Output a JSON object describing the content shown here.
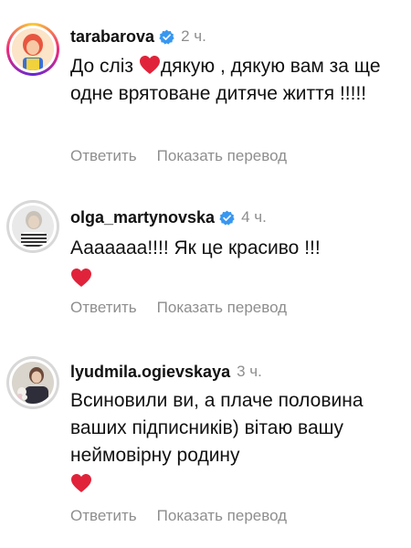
{
  "comments": [
    {
      "username": "tarabarova",
      "verified": true,
      "time": "2 ч.",
      "text_before_heart": "До сліз ",
      "text_after_heart": "дякую , дякую вам за ще одне врятоване дитяче життя !!!!!",
      "reply_label": "Ответить",
      "translate_label": "Показать перевод"
    },
    {
      "username": "olga_martynovska",
      "verified": true,
      "time": "4 ч.",
      "text": "Ааааааа!!!! Як це красиво !!!",
      "reply_label": "Ответить",
      "translate_label": "Показать перевод"
    },
    {
      "username": "lyudmila.ogievskaya",
      "verified": false,
      "time": "3 ч.",
      "text": "Всиновили ви, а плаче половина ваших підписників) вітаю вашу неймовірну родину",
      "reply_label": "Ответить",
      "translate_label": "Показать перевод"
    }
  ],
  "colors": {
    "text": "#111111",
    "muted": "#8e8e8e",
    "verified_badge": "#3897f0",
    "heart": "#e0233a"
  }
}
